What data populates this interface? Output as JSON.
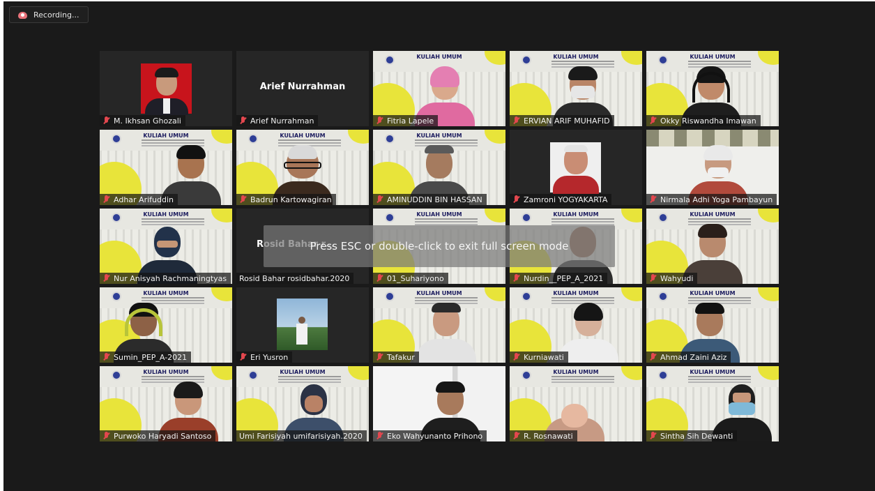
{
  "recording": {
    "label": "Recording...",
    "icon": "cloud-record-icon",
    "icon_color": "#e8727a"
  },
  "fullscreen_notice": "Press ESC or double-click to exit full screen mode",
  "slide_title": "KULIAH UMUM",
  "colors": {
    "background": "#1a1a1a",
    "mute_icon": "#e3474e",
    "active_speaker_border": "#cfe64a",
    "slide_accent": "#e8e43a"
  },
  "participants": [
    {
      "name": "M. Ikhsan Ghozali",
      "muted": true
    },
    {
      "name": "Arief Nurrahman",
      "muted": true,
      "display_name": "Arief Nurrahman"
    },
    {
      "name": "Fitria Lapele",
      "muted": true
    },
    {
      "name": "ERVIAN ARIF MUHAFID",
      "muted": true
    },
    {
      "name": "Okky Riswandha Imawan",
      "muted": true
    },
    {
      "name": "Adhar Arifuddin",
      "muted": true
    },
    {
      "name": "Badrun Kartowagiran",
      "muted": true
    },
    {
      "name": "AMINUDDIN BIN HASSAN",
      "muted": true
    },
    {
      "name": "Zamroni YOGYAKARTA",
      "muted": true
    },
    {
      "name": "Nirmala Adhi Yoga Pambayun",
      "muted": true
    },
    {
      "name": "Nur Anisyah Rachmaningtyas",
      "muted": true
    },
    {
      "name": "Rosid Bahar rosidbahar.2020",
      "muted": false,
      "display_name": "Rosid Bahar r..."
    },
    {
      "name": "01_Suhariyono",
      "muted": true
    },
    {
      "name": "Nurdin__PEP_A_2021",
      "muted": true
    },
    {
      "name": "Wahyudi",
      "muted": true
    },
    {
      "name": "Sumin_PEP_A-2021",
      "muted": true
    },
    {
      "name": "Eri Yusron",
      "muted": true
    },
    {
      "name": "Tafakur",
      "muted": true
    },
    {
      "name": "Kurniawati",
      "muted": true
    },
    {
      "name": "Ahmad Zaini Aziz",
      "muted": true
    },
    {
      "name": "Purwoko Haryadi Santoso",
      "muted": true
    },
    {
      "name": "Umi Farisiyah umifarisiyah.2020",
      "muted": false,
      "active_speaker": true
    },
    {
      "name": "Eko Wahyunanto Prihono",
      "muted": true
    },
    {
      "name": "R. Rosnawati",
      "muted": true
    },
    {
      "name": "Sintha Sih Dewanti",
      "muted": true
    }
  ]
}
